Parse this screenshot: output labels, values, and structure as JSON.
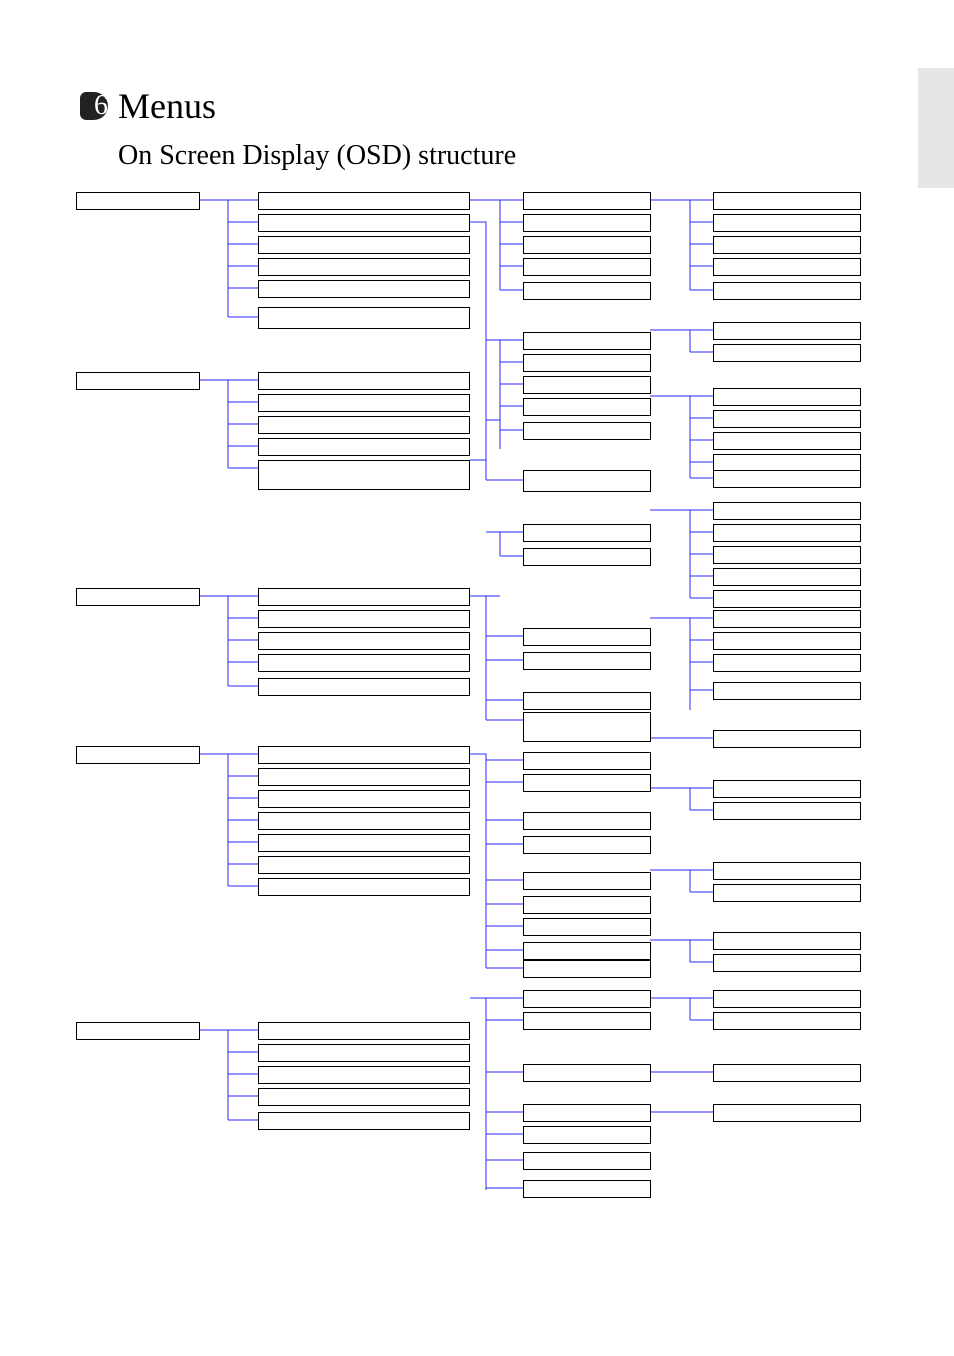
{
  "chapter_number": "6",
  "chapter_title": "Menus",
  "subtitle": "On Screen Display (OSD) structure",
  "tree": {}
}
